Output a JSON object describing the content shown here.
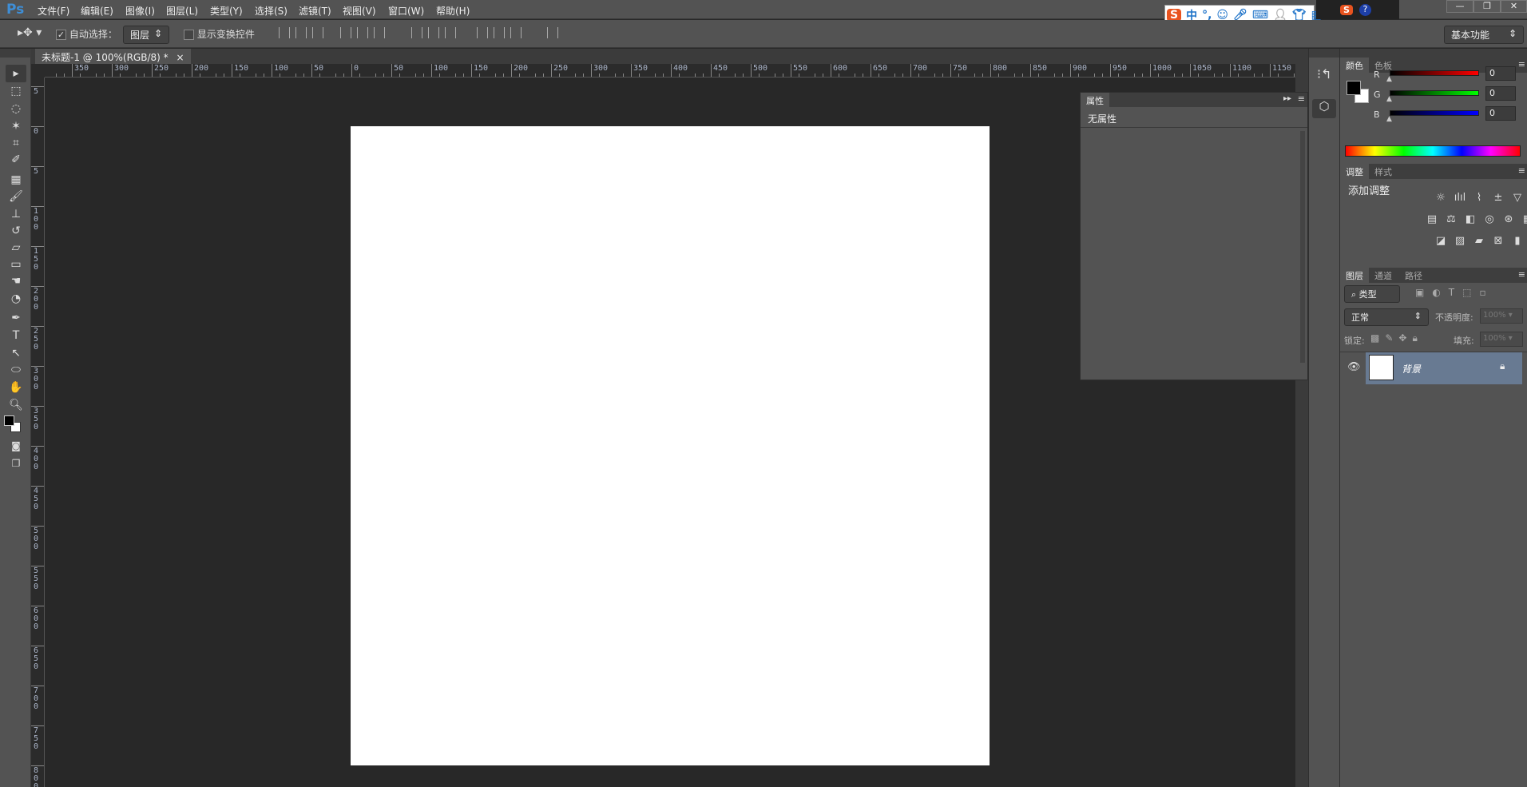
{
  "app": {
    "logo": "Ps"
  },
  "menu": [
    "文件(F)",
    "编辑(E)",
    "图像(I)",
    "图层(L)",
    "类型(Y)",
    "选择(S)",
    "滤镜(T)",
    "视图(V)",
    "窗口(W)",
    "帮助(H)"
  ],
  "ime": {
    "logo": "S",
    "mode": "中",
    "punct": "°,"
  },
  "window_controls": {
    "minimize": "—",
    "restore": "❐",
    "close": "✕"
  },
  "options": {
    "auto_select_label": "自动选择：",
    "auto_select_checked": true,
    "auto_select_value": "图层",
    "show_transform_label": "显示变换控件",
    "workspace": "基本功能"
  },
  "document": {
    "tab_title": "未标题-1 @ 100%(RGB/8) *",
    "close": "×"
  },
  "ruler": {
    "h_labels": [
      "350",
      "300",
      "250",
      "200",
      "150",
      "100",
      "50",
      "0",
      "50",
      "100",
      "150",
      "200",
      "250",
      "300",
      "350",
      "400",
      "450",
      "500",
      "550",
      "600",
      "650",
      "700",
      "750",
      "800",
      "850",
      "900",
      "950",
      "1000",
      "1050",
      "1100",
      "1150"
    ],
    "v_labels": [
      "5",
      "0",
      "5",
      "1 0 0",
      "1 5 0",
      "2 0 0",
      "2 5 0",
      "3 0 0",
      "3 5 0",
      "4 0 0",
      "4 5 0",
      "5 0 0",
      "5 5 0",
      "6 0 0",
      "6 5 0",
      "7 0 0",
      "7 5 0",
      "8 0 0"
    ]
  },
  "properties": {
    "tab": "属性",
    "empty": "无属性"
  },
  "color_panel": {
    "tabs": [
      "颜色",
      "色板"
    ],
    "channels": [
      {
        "label": "R",
        "value": "0",
        "color": "#ff0000"
      },
      {
        "label": "G",
        "value": "0",
        "color": "#00ff00"
      },
      {
        "label": "B",
        "value": "0",
        "color": "#0000ff"
      }
    ]
  },
  "adjustments": {
    "tabs": [
      "调整",
      "样式"
    ],
    "title": "添加调整"
  },
  "layers": {
    "tabs": [
      "图层",
      "通道",
      "路径"
    ],
    "filter": "类型",
    "blend_mode": "正常",
    "opacity_label": "不透明度:",
    "opacity": "100%",
    "lock_label": "锁定:",
    "fill_label": "填充:",
    "fill": "100%",
    "items": [
      {
        "name": "背景",
        "visible": true,
        "locked": true
      }
    ]
  }
}
